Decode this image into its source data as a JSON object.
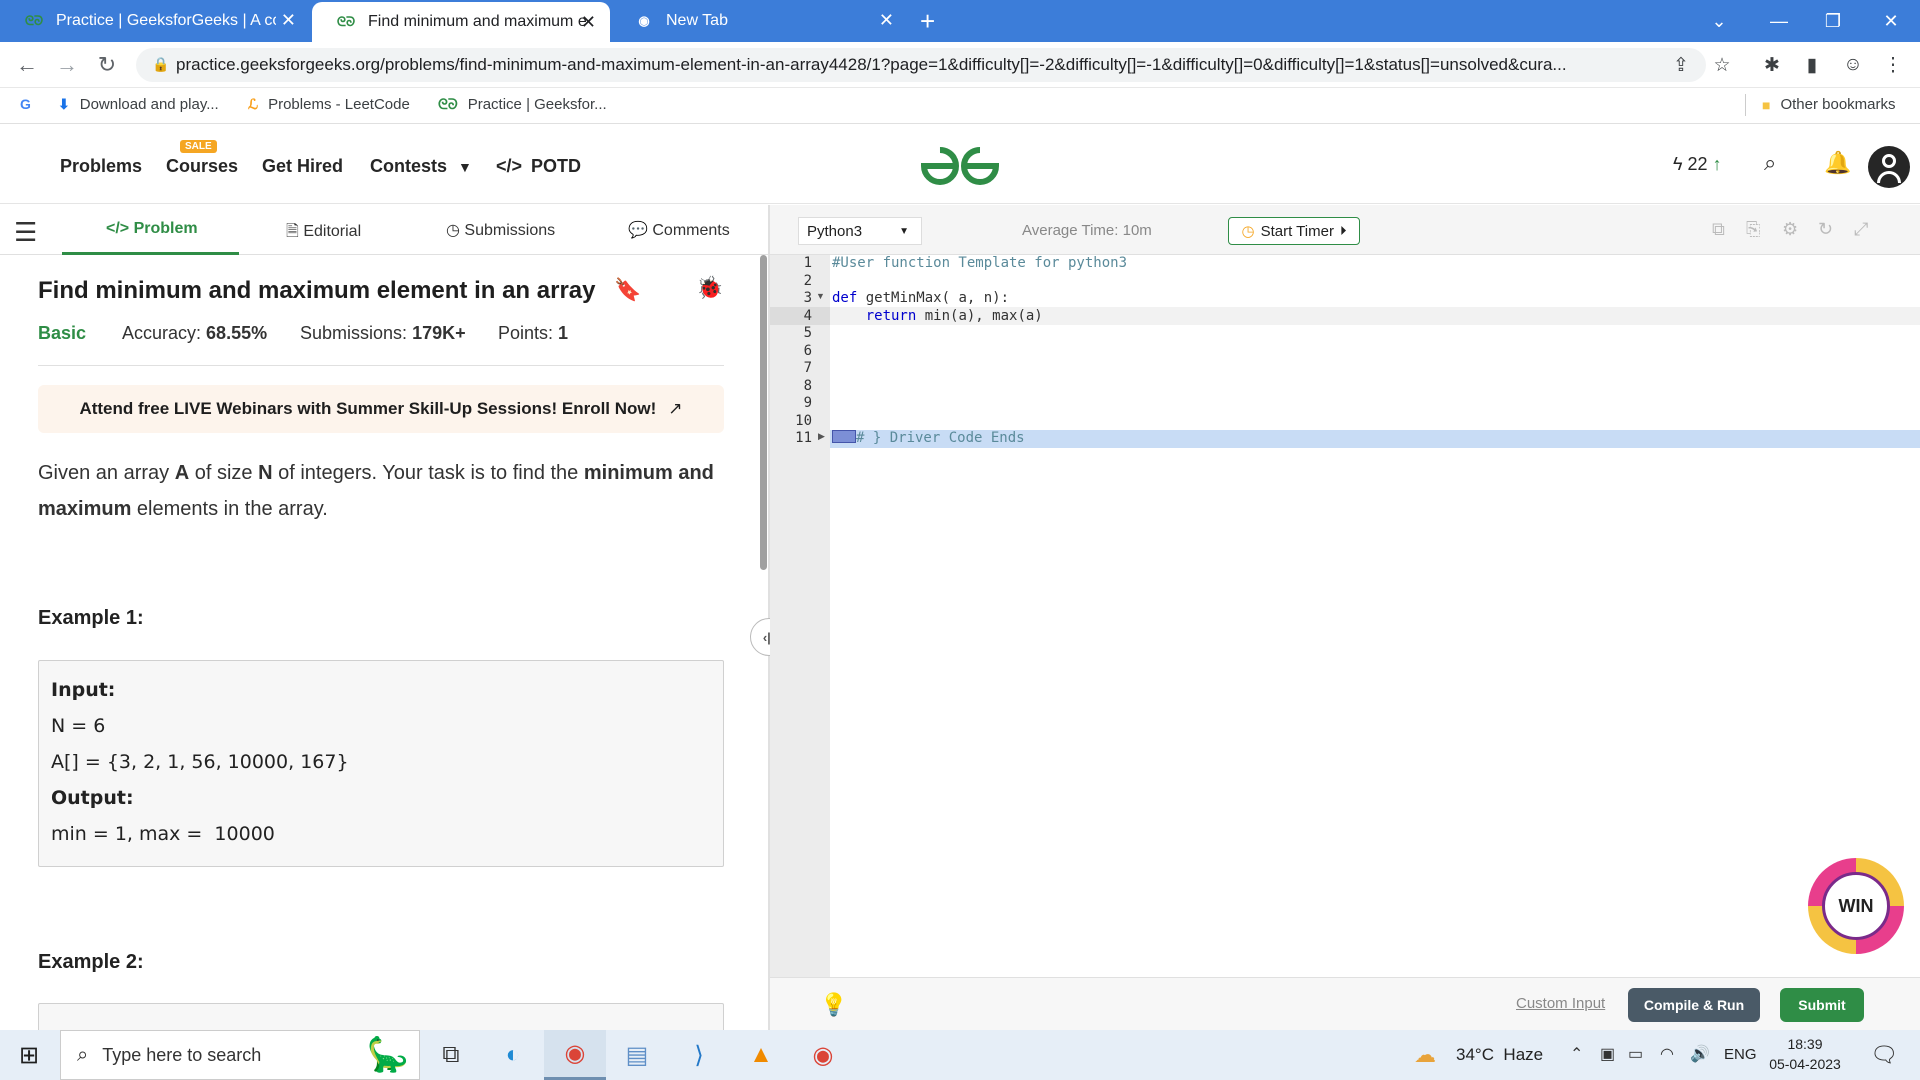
{
  "browser": {
    "tabs": [
      {
        "title": "Practice | GeeksforGeeks | A com",
        "icon": "gfg-icon"
      },
      {
        "title": "Find minimum and maximum ele",
        "icon": "gfg-icon"
      },
      {
        "title": "New Tab",
        "icon": "chrome-icon"
      }
    ],
    "new_tab": "+",
    "url": "practice.geeksforgeeks.org/problems/find-minimum-and-maximum-element-in-an-array4428/1?page=1&difficulty[]=-2&difficulty[]=-1&difficulty[]=0&difficulty[]=1&status[]=unsolved&cura...",
    "bookmarks": [
      {
        "label": "Download and play..."
      },
      {
        "label": "Problems - LeetCode"
      },
      {
        "label": "Practice | Geeksfor..."
      }
    ],
    "other_bookmarks": "Other bookmarks"
  },
  "site": {
    "nav": {
      "problems": "Problems",
      "courses": "Courses",
      "sale_badge": "SALE",
      "get_hired": "Get Hired",
      "contests": "Contests",
      "potd": "POTD"
    },
    "logo_text": "GfG",
    "streak": "22"
  },
  "problem_tabs": {
    "problem": "Problem",
    "editorial": "Editorial",
    "submissions": "Submissions",
    "comments": "Comments"
  },
  "problem": {
    "title": "Find minimum and maximum element in an array",
    "difficulty": "Basic",
    "accuracy_label": "Accuracy:",
    "accuracy": "68.55%",
    "submissions_label": "Submissions:",
    "submissions": "179K+",
    "points_label": "Points:",
    "points": "1",
    "banner": "Attend free LIVE Webinars with Summer Skill-Up Sessions! Enroll Now!",
    "desc_1": "Given an array ",
    "desc_A": "A",
    "desc_2": " of size ",
    "desc_N": "N",
    "desc_3": " of integers. Your task is to find the ",
    "desc_minmax": "minimum and maximum",
    "desc_4": " elements in the array.",
    "example1_heading": "Example 1:",
    "input_label": "Input:",
    "input_line1": "N = 6",
    "input_line2": "A[] = {3, 2, 1, 56, 10000, 167}",
    "output_label": "Output:",
    "output_line": "min = 1, max =  10000",
    "example2_heading": "Example 2:"
  },
  "editor": {
    "language": "Python3",
    "avg_time": "Average Time: 10m",
    "start_timer": "Start Timer",
    "line_numbers": [
      "1",
      "2",
      "3",
      "4",
      "5",
      "6",
      "7",
      "8",
      "9",
      "10",
      "11"
    ],
    "lines": {
      "l1": "#User function Template for python3",
      "l3_kw": "def",
      "l3_rest": " getMinMax( a, n):",
      "l4_kw": "return",
      "l4_rest": " min(a), max(a)",
      "l11": "# } Driver Code Ends"
    },
    "custom_input": "Custom Input",
    "compile_run": "Compile & Run",
    "submit": "Submit",
    "win_badge": "WIN"
  },
  "taskbar": {
    "search_placeholder": "Type here to search",
    "weather": "34°C  Haze",
    "lang": "ENG",
    "time": "18:39",
    "date": "05-04-2023"
  },
  "colors": {
    "gfg_green": "#2f8d46",
    "tabstrip_blue": "#3c7dd9",
    "compile_btn": "#4a5a67"
  }
}
